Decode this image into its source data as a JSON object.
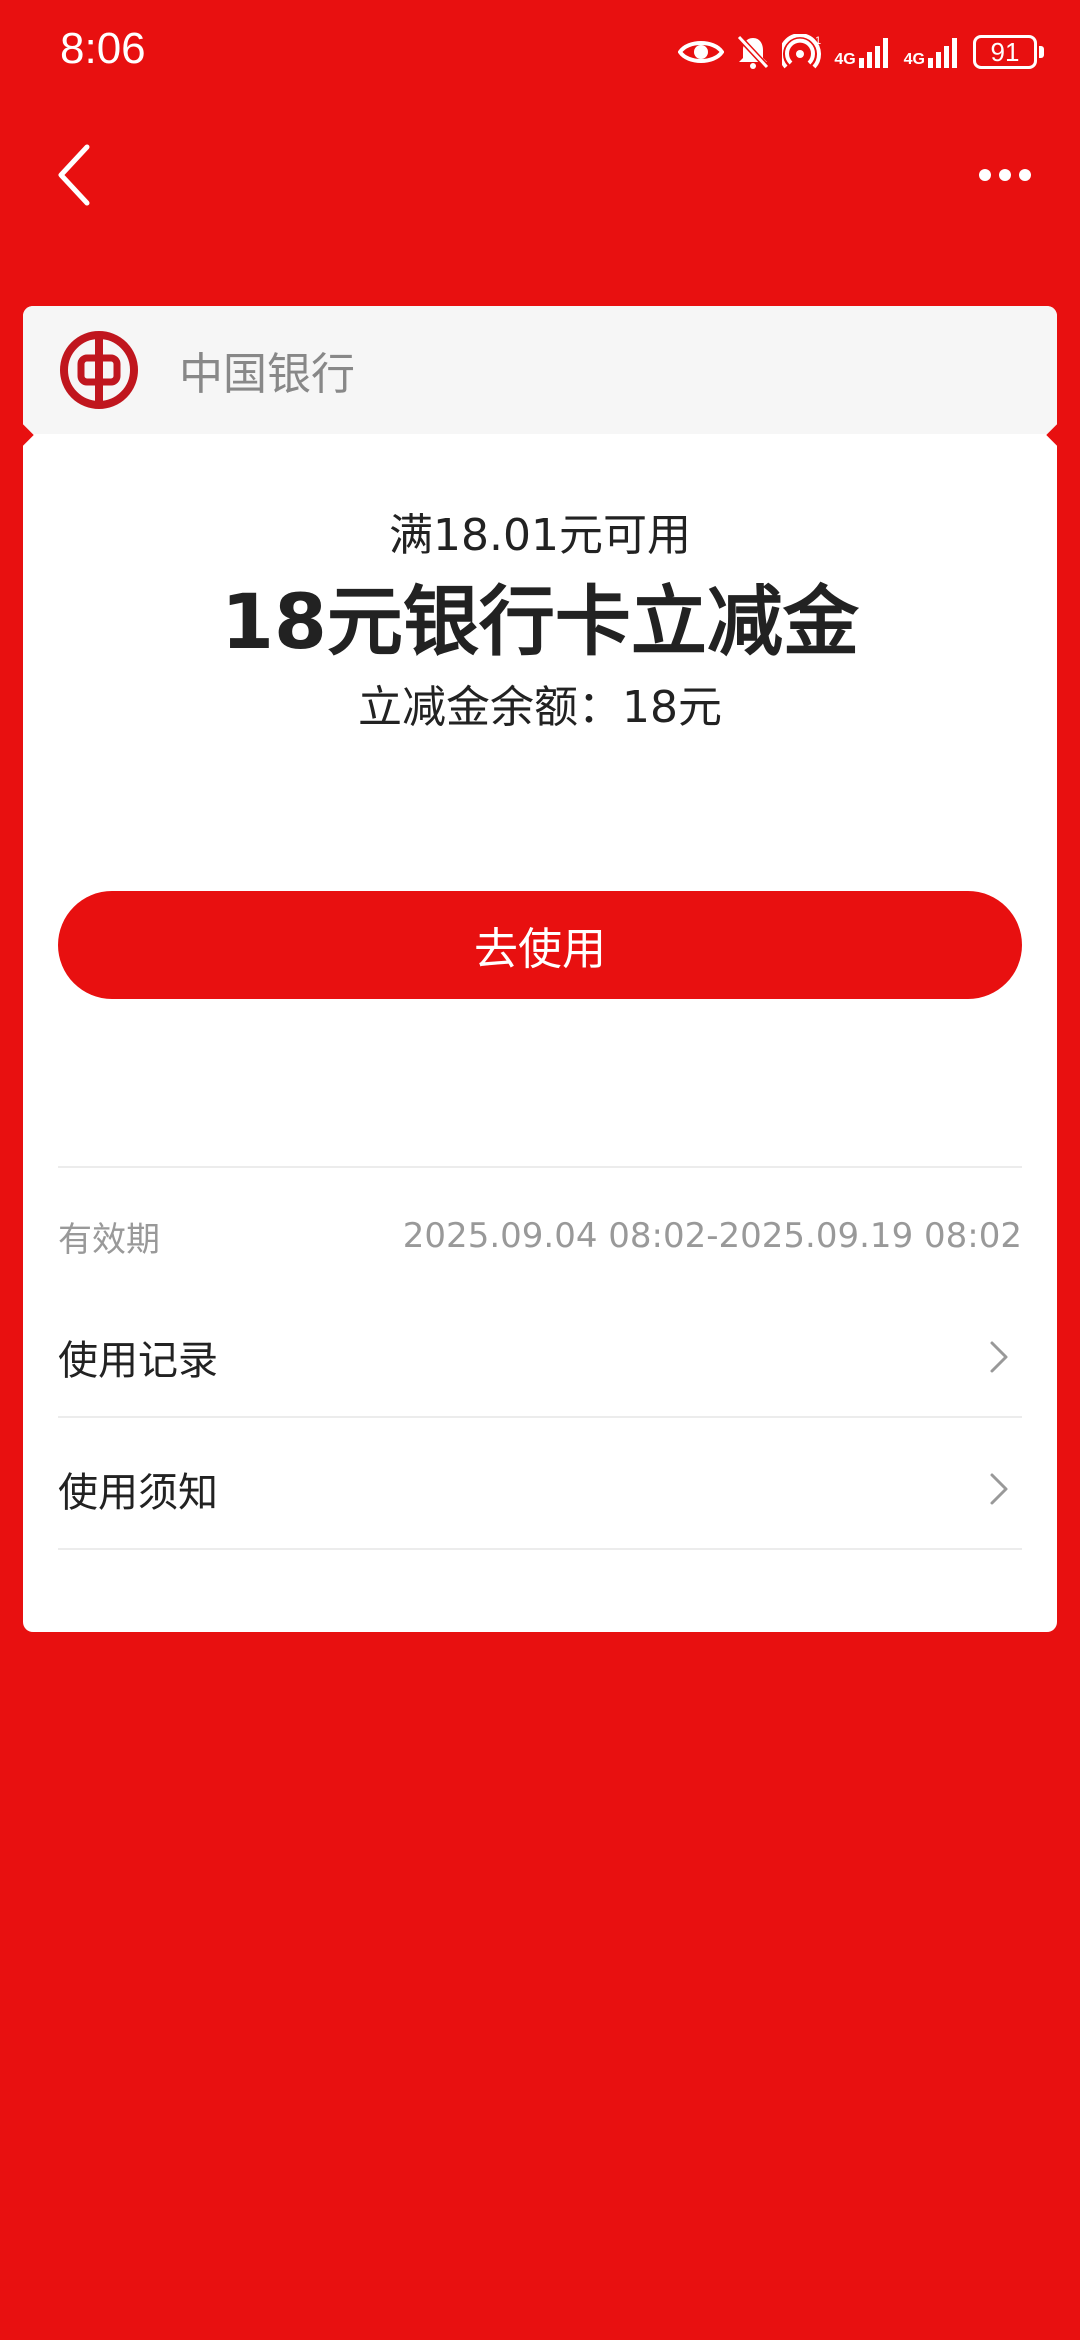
{
  "status_bar": {
    "time": "8:06",
    "battery": "91",
    "network_1": "4G",
    "network_2": "4G",
    "icons": [
      "eye-icon",
      "bell-muted-icon",
      "hotspot-icon",
      "signal-icon",
      "signal-icon"
    ]
  },
  "nav": {
    "back_icon": "chevron-left-icon",
    "more_icon": "more-dots-icon"
  },
  "bank": {
    "name": "中国银行",
    "logo_icon": "bank-of-china-logo"
  },
  "coupon": {
    "condition": "满18.01元可用",
    "title": "18元银行卡立减金",
    "balance": "立减金余额：18元"
  },
  "use_button": {
    "label": "去使用"
  },
  "validity": {
    "label": "有效期",
    "value": "2025.09.04 08:02-2025.09.19 08:02"
  },
  "menu": [
    {
      "label": "使用记录"
    },
    {
      "label": "使用须知"
    }
  ],
  "colors": {
    "brand_red": "#e81010",
    "card_bg": "#ffffff",
    "header_bg": "#f6f6f6"
  }
}
